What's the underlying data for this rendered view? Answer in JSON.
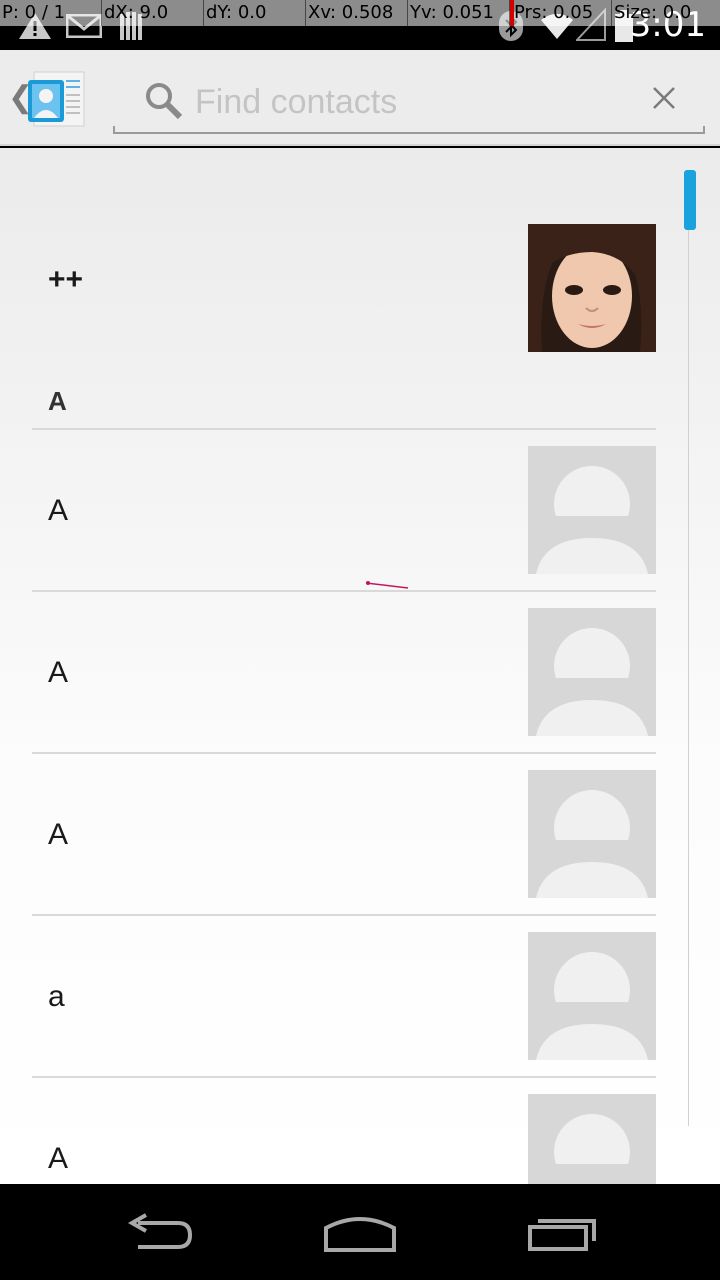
{
  "pointer_overlay": {
    "p": "P: 0 / 1",
    "dx": "dX: 9.0",
    "dy": "dY: 0.0",
    "xv": "Xv: 0.508",
    "yv": "Yv: 0.051",
    "prs": "Prs: 0.05",
    "size": "Size: 0.0"
  },
  "status_bar": {
    "time": "3:01",
    "icons": [
      "warning-icon",
      "gmail-icon",
      "bars-icon",
      "bluetooth-icon",
      "wifi-icon",
      "signal-icon",
      "battery-icon"
    ]
  },
  "action_bar": {
    "app_icon": "contacts-app-icon",
    "search_placeholder": "Find contacts",
    "search_value": ""
  },
  "contacts": {
    "favorite": {
      "name": "++"
    },
    "section_a": {
      "header": "A"
    },
    "rows": [
      {
        "name": "A"
      },
      {
        "name": "A"
      },
      {
        "name": "A"
      },
      {
        "name": "a"
      },
      {
        "name": "A"
      }
    ]
  },
  "colors": {
    "accent": "#1aa2dc",
    "placeholder_photo_bg": "#d7d7d7",
    "placeholder_photo_fg": "#f0f0f0"
  },
  "nav_bar": {
    "buttons": [
      "back-icon",
      "home-icon",
      "recents-icon"
    ]
  }
}
